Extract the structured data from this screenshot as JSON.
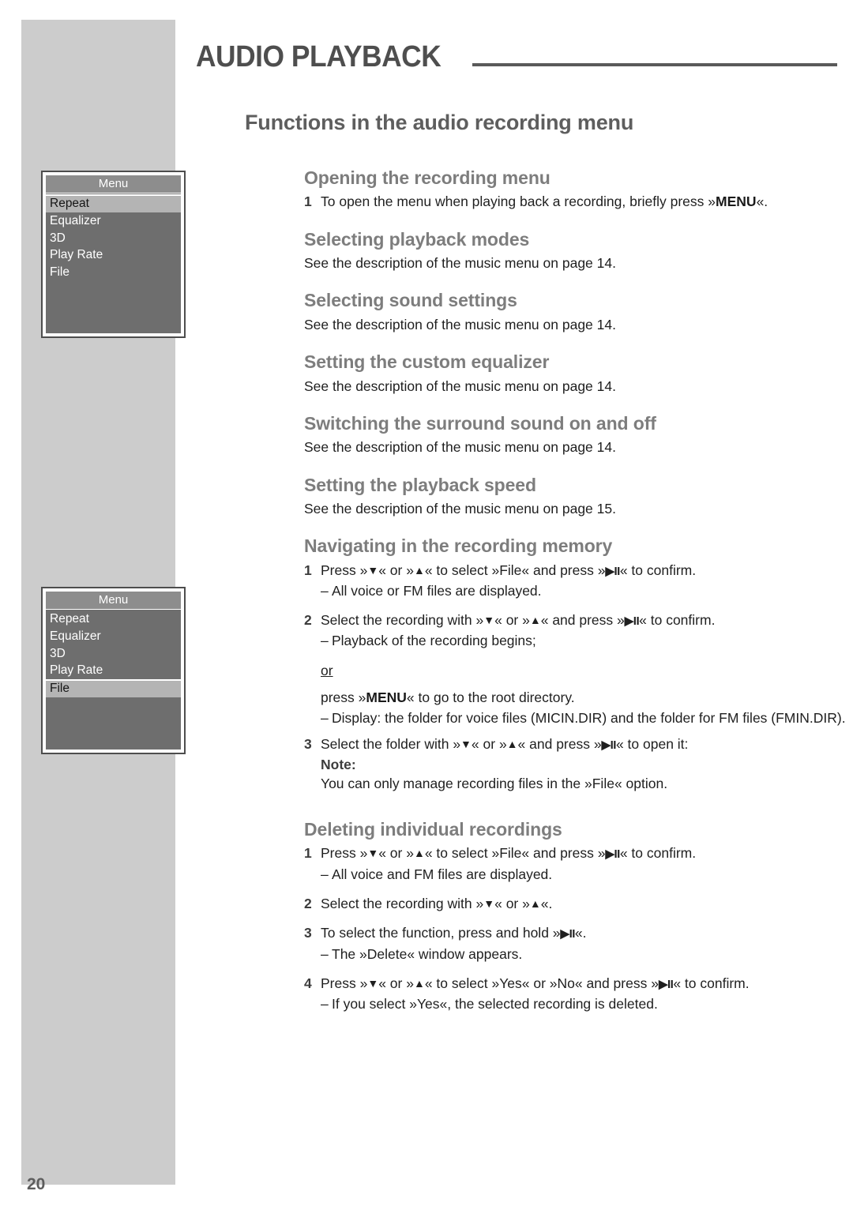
{
  "page": {
    "number": "20",
    "running_header": "AUDIO PLAYBACK",
    "chapter_title": "Functions in the audio recording menu"
  },
  "glyphs": {
    "down": "▼",
    "up": "▲",
    "play_pause": "▶II",
    "quote_open": "»",
    "quote_close": "«",
    "dash": "–"
  },
  "device_menus": [
    {
      "name": "recording-menu-repeat",
      "title": "Menu",
      "items": [
        "Repeat",
        "Equalizer",
        "3D",
        "Play Rate",
        "File"
      ],
      "selected": "Repeat"
    },
    {
      "name": "recording-menu-file",
      "title": "Menu",
      "items": [
        "Repeat",
        "Equalizer",
        "3D",
        "Play Rate",
        "File"
      ],
      "selected": "File"
    }
  ],
  "sections": {
    "opening": {
      "heading": "Opening the recording menu",
      "step1_num": "1",
      "step1_a": "To open the menu when playing back a recording, briefly press ",
      "step1_key": "MENU",
      "step1_b": "."
    },
    "playback_modes": {
      "heading": "Selecting playback modes",
      "body": "See the description of the music menu on page 14."
    },
    "sound_settings": {
      "heading": "Selecting sound settings",
      "body": "See the description of the music menu on page 14."
    },
    "custom_equalizer": {
      "heading": "Setting the custom equalizer",
      "body": "See the description of the music menu on page 14."
    },
    "surround": {
      "heading": "Switching the surround sound on and off",
      "body": "See the description of the music menu on page 14."
    },
    "playback_speed": {
      "heading": "Setting the playback speed",
      "body": "See the description of the music menu on page 15."
    },
    "navigating": {
      "heading": "Navigating in the recording memory",
      "s1_num": "1",
      "s1_t1": "Press ",
      "s1_t2": " or ",
      "s1_t3": " to select ",
      "s1_file": "»File«",
      "s1_t4": " and press ",
      "s1_t5": " to confirm.",
      "s1_sub": "All voice or FM files are displayed.",
      "s2_num": "2",
      "s2_t1": "Select the recording with ",
      "s2_t2": " or ",
      "s2_t3": " and press ",
      "s2_t4": " to confirm.",
      "s2_sub": "Playback of the recording begins;",
      "or": "or",
      "menu_line_a": "press ",
      "menu_line_key": "MENU",
      "menu_line_b": " to go to the root directory.",
      "display_sub": "Display: the folder for voice files (MICIN.DIR) and the folder for FM files (FMIN.DIR).",
      "s3_num": "3",
      "s3_t1": "Select the folder with ",
      "s3_t2": " or ",
      "s3_t3": " and press ",
      "s3_t4": " to open it:",
      "note_label": "Note:",
      "note_text": "You can only manage recording files in the »File« option."
    },
    "deleting": {
      "heading": "Deleting individual recordings",
      "s1_num": "1",
      "s1_t1": "Press ",
      "s1_t2": " or ",
      "s1_t3": " to select ",
      "s1_file": "»File«",
      "s1_t4": " and press ",
      "s1_t5": " to confirm.",
      "s1_sub": "All voice and FM files are displayed.",
      "s2_num": "2",
      "s2_t1": "Select the recording with ",
      "s2_t2": " or ",
      "s2_t3": ".",
      "s3_num": "3",
      "s3_t1": "To select the function, press and hold ",
      "s3_t2": ".",
      "s3_sub": "The »Delete« window appears.",
      "s4_num": "4",
      "s4_t1": "Press ",
      "s4_t2": " or ",
      "s4_t3": " to select ",
      "s4_yes": "»Yes«",
      "s4_t4": " or ",
      "s4_no": "»No«",
      "s4_t5": " and press ",
      "s4_t6": " to confirm.",
      "s4_sub": "If you select »Yes«, the selected recording is deleted."
    }
  }
}
